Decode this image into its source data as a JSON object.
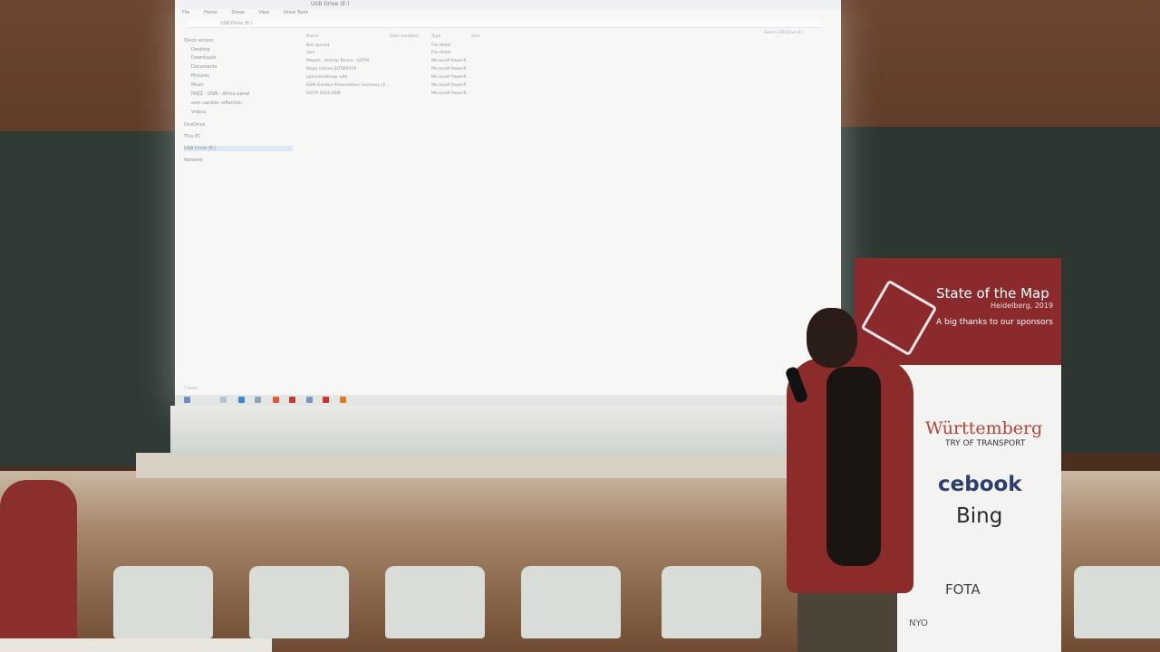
{
  "explorer": {
    "title": "USB Drive (E:)",
    "tabs": [
      "File",
      "Home",
      "Share",
      "View",
      "Drive Tools"
    ],
    "address": "USB Drive (E:)",
    "search_placeholder": "Search USB Drive (E:)",
    "nav_items": [
      "Quick access",
      "Desktop",
      "Downloads",
      "Documents",
      "Pictures",
      "Music",
      "PREZ - OSM - Africa panel",
      "osm candler reflection",
      "Videos",
      "OneDrive",
      "This PC",
      "USB Drive (E:)",
      "Network"
    ],
    "selected_nav": "USB Drive (E:)",
    "columns": [
      "Name",
      "Date modified",
      "Type",
      "Size"
    ],
    "files": [
      {
        "name": "Not synced",
        "type": "File folder",
        "size": ""
      },
      {
        "name": "osm",
        "type": "File folder",
        "size": ""
      },
      {
        "name": "MapaH - Animar Banca - SOTM",
        "type": "Microsoft PowerP...",
        "size": ""
      },
      {
        "name": "Mapa outline SOTM2019",
        "type": "Microsoft PowerP...",
        "size": ""
      },
      {
        "name": "openstreetmap cafe",
        "type": "Microsoft PowerP...",
        "size": ""
      },
      {
        "name": "OSM Gambia Presentation Germany (2...",
        "type": "Microsoft PowerP...",
        "size": ""
      },
      {
        "name": "SOTM 2019 DSM",
        "type": "Microsoft PowerP...",
        "size": ""
      }
    ],
    "status": "7 items"
  },
  "banner": {
    "title": "State of the Map",
    "subtitle": "Heidelberg, 2019",
    "thanks": "A big thanks to our sponsors",
    "sponsors": [
      "Württemberg",
      "TRY OF TRANSPORT",
      "cebook",
      "Bing",
      "FOTA",
      "NYO"
    ]
  },
  "colors": {
    "banner_red": "#8a2a2d",
    "shirt_red": "#8b2b2a",
    "screen": "#f7f8f6"
  }
}
